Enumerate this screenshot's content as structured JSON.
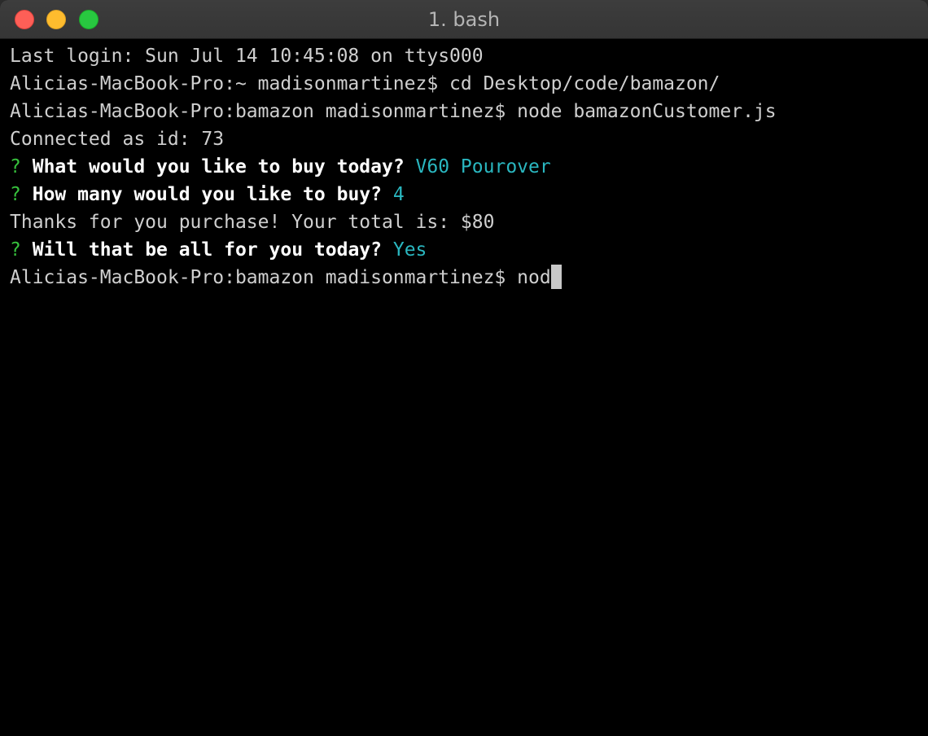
{
  "window": {
    "title": "1. bash"
  },
  "terminal": {
    "lines": {
      "login": "Last login: Sun Jul 14 10:45:08 on ttys000",
      "cd_prompt": "Alicias-MacBook-Pro:~ madisonmartinez$ ",
      "cd_command": "cd Desktop/code/bamazon/",
      "node_prompt": "Alicias-MacBook-Pro:bamazon madisonmartinez$ ",
      "node_command": "node bamazonCustomer.js",
      "connected": "Connected as id: 73",
      "q1_mark": "?",
      "q1_text": "What would you like to buy today?",
      "q1_answer": "V60 Pourover",
      "q2_mark": "?",
      "q2_text": "How many would you like to buy?",
      "q2_answer": "4",
      "thanks": "Thanks for you purchase! Your total is: $80",
      "q3_mark": "?",
      "q3_text": "Will that be all for you today?",
      "q3_answer": "Yes",
      "final_prompt": "Alicias-MacBook-Pro:bamazon madisonmartinez$ ",
      "final_input": "nod"
    }
  },
  "colors": {
    "background": "#000000",
    "text": "#cfcfcf",
    "question_mark": "#37c13d",
    "answer": "#2ab7c0",
    "close": "#fe5f57",
    "minimize": "#febc2e",
    "zoom": "#28c840"
  }
}
